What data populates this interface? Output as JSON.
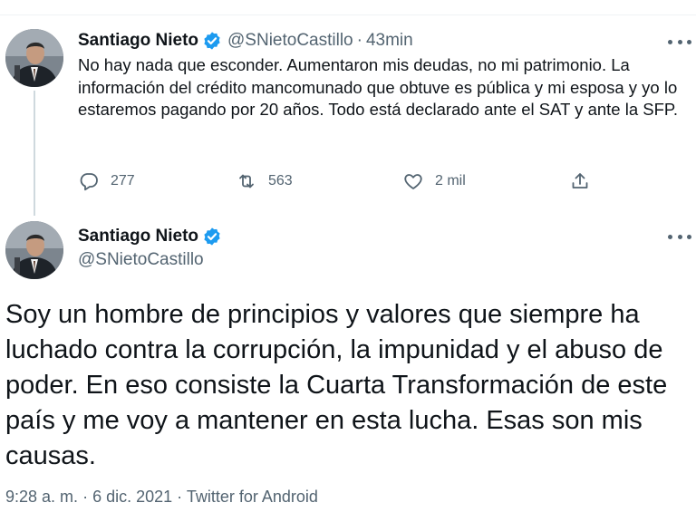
{
  "reply_tweet": {
    "author_name": "Santiago Nieto",
    "handle": "@SNietoCastillo",
    "separator": "·",
    "time": "43min",
    "text": "No hay nada que esconder. Aumentaron mis deudas, no mi patrimonio. La información del crédito mancomunado que obtuve es pública y mi esposa y yo lo estaremos pagando por 20 años. Todo está declarado ante el SAT y ante la SFP.",
    "actions": {
      "replies": "277",
      "retweets": "563",
      "likes": "2 mil"
    }
  },
  "main_tweet": {
    "author_name": "Santiago Nieto",
    "handle": "@SNietoCastillo",
    "text": "Soy un hombre de principios y valores que siempre ha luchado contra la corrupción, la impunidad y el abuso de poder. En eso consiste la Cuarta Transformación de este país y me voy a mantener en esta lucha. Esas son mis causas.",
    "timestamp": "9:28 a. m.",
    "separator": "·",
    "date": "6 dic. 2021",
    "source": "Twitter for Android"
  },
  "colors": {
    "verified": "#1d9bf0",
    "secondary_text": "#536471",
    "primary_text": "#0f1419"
  },
  "icons": [
    "verified-badge-icon",
    "more-icon",
    "reply-icon",
    "retweet-icon",
    "like-icon",
    "share-icon"
  ]
}
